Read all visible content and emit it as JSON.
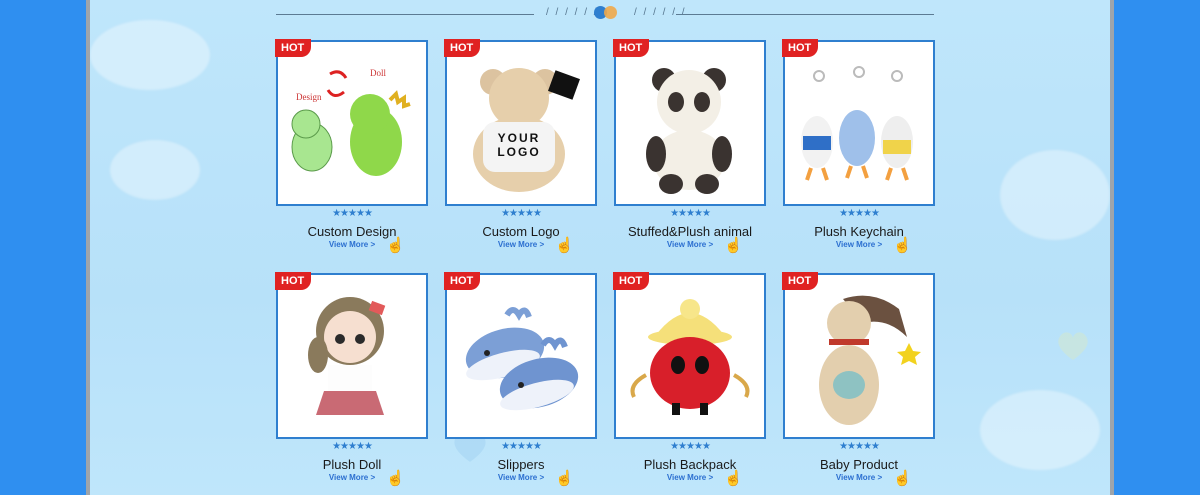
{
  "badge": "HOT",
  "rating_stars": "★★★★★",
  "view_more": "View More >",
  "divider_slashes": "/ / / / / /",
  "products": [
    {
      "title": "Custom Design",
      "image_text": [
        "Design",
        "Doll"
      ]
    },
    {
      "title": "Custom Logo",
      "image_text": [
        "YOUR",
        "LOGO"
      ]
    },
    {
      "title": "Stuffed&Plush animal"
    },
    {
      "title": "Plush Keychain"
    },
    {
      "title": "Plush Doll"
    },
    {
      "title": "Slippers"
    },
    {
      "title": "Plush Backpack"
    },
    {
      "title": "Baby Product"
    }
  ],
  "colors": {
    "accent": "#2f7fcf",
    "badge": "#e02222",
    "page_bg": "#2f8ff0",
    "panel_bg": "#bfe6fb"
  }
}
